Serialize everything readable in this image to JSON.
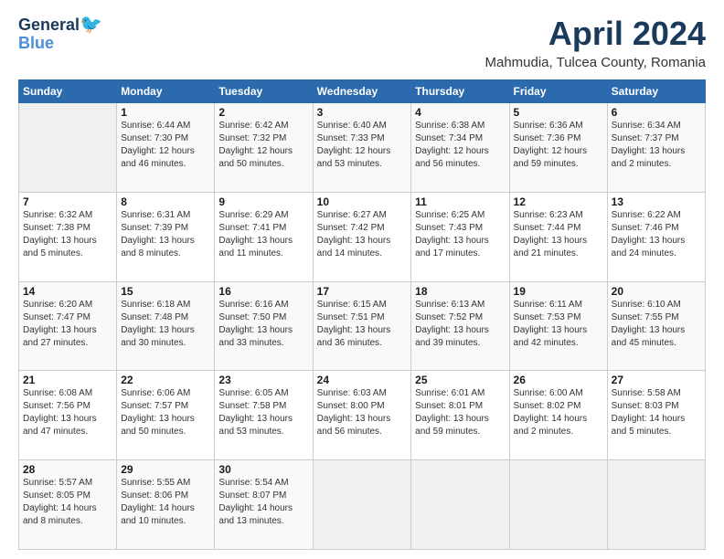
{
  "header": {
    "logo_general": "General",
    "logo_blue": "Blue",
    "month_title": "April 2024",
    "subtitle": "Mahmudia, Tulcea County, Romania"
  },
  "weekdays": [
    "Sunday",
    "Monday",
    "Tuesday",
    "Wednesday",
    "Thursday",
    "Friday",
    "Saturday"
  ],
  "weeks": [
    [
      {
        "day": "",
        "sunrise": "",
        "sunset": "",
        "daylight": ""
      },
      {
        "day": "1",
        "sunrise": "Sunrise: 6:44 AM",
        "sunset": "Sunset: 7:30 PM",
        "daylight": "Daylight: 12 hours and 46 minutes."
      },
      {
        "day": "2",
        "sunrise": "Sunrise: 6:42 AM",
        "sunset": "Sunset: 7:32 PM",
        "daylight": "Daylight: 12 hours and 50 minutes."
      },
      {
        "day": "3",
        "sunrise": "Sunrise: 6:40 AM",
        "sunset": "Sunset: 7:33 PM",
        "daylight": "Daylight: 12 hours and 53 minutes."
      },
      {
        "day": "4",
        "sunrise": "Sunrise: 6:38 AM",
        "sunset": "Sunset: 7:34 PM",
        "daylight": "Daylight: 12 hours and 56 minutes."
      },
      {
        "day": "5",
        "sunrise": "Sunrise: 6:36 AM",
        "sunset": "Sunset: 7:36 PM",
        "daylight": "Daylight: 12 hours and 59 minutes."
      },
      {
        "day": "6",
        "sunrise": "Sunrise: 6:34 AM",
        "sunset": "Sunset: 7:37 PM",
        "daylight": "Daylight: 13 hours and 2 minutes."
      }
    ],
    [
      {
        "day": "7",
        "sunrise": "Sunrise: 6:32 AM",
        "sunset": "Sunset: 7:38 PM",
        "daylight": "Daylight: 13 hours and 5 minutes."
      },
      {
        "day": "8",
        "sunrise": "Sunrise: 6:31 AM",
        "sunset": "Sunset: 7:39 PM",
        "daylight": "Daylight: 13 hours and 8 minutes."
      },
      {
        "day": "9",
        "sunrise": "Sunrise: 6:29 AM",
        "sunset": "Sunset: 7:41 PM",
        "daylight": "Daylight: 13 hours and 11 minutes."
      },
      {
        "day": "10",
        "sunrise": "Sunrise: 6:27 AM",
        "sunset": "Sunset: 7:42 PM",
        "daylight": "Daylight: 13 hours and 14 minutes."
      },
      {
        "day": "11",
        "sunrise": "Sunrise: 6:25 AM",
        "sunset": "Sunset: 7:43 PM",
        "daylight": "Daylight: 13 hours and 17 minutes."
      },
      {
        "day": "12",
        "sunrise": "Sunrise: 6:23 AM",
        "sunset": "Sunset: 7:44 PM",
        "daylight": "Daylight: 13 hours and 21 minutes."
      },
      {
        "day": "13",
        "sunrise": "Sunrise: 6:22 AM",
        "sunset": "Sunset: 7:46 PM",
        "daylight": "Daylight: 13 hours and 24 minutes."
      }
    ],
    [
      {
        "day": "14",
        "sunrise": "Sunrise: 6:20 AM",
        "sunset": "Sunset: 7:47 PM",
        "daylight": "Daylight: 13 hours and 27 minutes."
      },
      {
        "day": "15",
        "sunrise": "Sunrise: 6:18 AM",
        "sunset": "Sunset: 7:48 PM",
        "daylight": "Daylight: 13 hours and 30 minutes."
      },
      {
        "day": "16",
        "sunrise": "Sunrise: 6:16 AM",
        "sunset": "Sunset: 7:50 PM",
        "daylight": "Daylight: 13 hours and 33 minutes."
      },
      {
        "day": "17",
        "sunrise": "Sunrise: 6:15 AM",
        "sunset": "Sunset: 7:51 PM",
        "daylight": "Daylight: 13 hours and 36 minutes."
      },
      {
        "day": "18",
        "sunrise": "Sunrise: 6:13 AM",
        "sunset": "Sunset: 7:52 PM",
        "daylight": "Daylight: 13 hours and 39 minutes."
      },
      {
        "day": "19",
        "sunrise": "Sunrise: 6:11 AM",
        "sunset": "Sunset: 7:53 PM",
        "daylight": "Daylight: 13 hours and 42 minutes."
      },
      {
        "day": "20",
        "sunrise": "Sunrise: 6:10 AM",
        "sunset": "Sunset: 7:55 PM",
        "daylight": "Daylight: 13 hours and 45 minutes."
      }
    ],
    [
      {
        "day": "21",
        "sunrise": "Sunrise: 6:08 AM",
        "sunset": "Sunset: 7:56 PM",
        "daylight": "Daylight: 13 hours and 47 minutes."
      },
      {
        "day": "22",
        "sunrise": "Sunrise: 6:06 AM",
        "sunset": "Sunset: 7:57 PM",
        "daylight": "Daylight: 13 hours and 50 minutes."
      },
      {
        "day": "23",
        "sunrise": "Sunrise: 6:05 AM",
        "sunset": "Sunset: 7:58 PM",
        "daylight": "Daylight: 13 hours and 53 minutes."
      },
      {
        "day": "24",
        "sunrise": "Sunrise: 6:03 AM",
        "sunset": "Sunset: 8:00 PM",
        "daylight": "Daylight: 13 hours and 56 minutes."
      },
      {
        "day": "25",
        "sunrise": "Sunrise: 6:01 AM",
        "sunset": "Sunset: 8:01 PM",
        "daylight": "Daylight: 13 hours and 59 minutes."
      },
      {
        "day": "26",
        "sunrise": "Sunrise: 6:00 AM",
        "sunset": "Sunset: 8:02 PM",
        "daylight": "Daylight: 14 hours and 2 minutes."
      },
      {
        "day": "27",
        "sunrise": "Sunrise: 5:58 AM",
        "sunset": "Sunset: 8:03 PM",
        "daylight": "Daylight: 14 hours and 5 minutes."
      }
    ],
    [
      {
        "day": "28",
        "sunrise": "Sunrise: 5:57 AM",
        "sunset": "Sunset: 8:05 PM",
        "daylight": "Daylight: 14 hours and 8 minutes."
      },
      {
        "day": "29",
        "sunrise": "Sunrise: 5:55 AM",
        "sunset": "Sunset: 8:06 PM",
        "daylight": "Daylight: 14 hours and 10 minutes."
      },
      {
        "day": "30",
        "sunrise": "Sunrise: 5:54 AM",
        "sunset": "Sunset: 8:07 PM",
        "daylight": "Daylight: 14 hours and 13 minutes."
      },
      {
        "day": "",
        "sunrise": "",
        "sunset": "",
        "daylight": ""
      },
      {
        "day": "",
        "sunrise": "",
        "sunset": "",
        "daylight": ""
      },
      {
        "day": "",
        "sunrise": "",
        "sunset": "",
        "daylight": ""
      },
      {
        "day": "",
        "sunrise": "",
        "sunset": "",
        "daylight": ""
      }
    ]
  ]
}
